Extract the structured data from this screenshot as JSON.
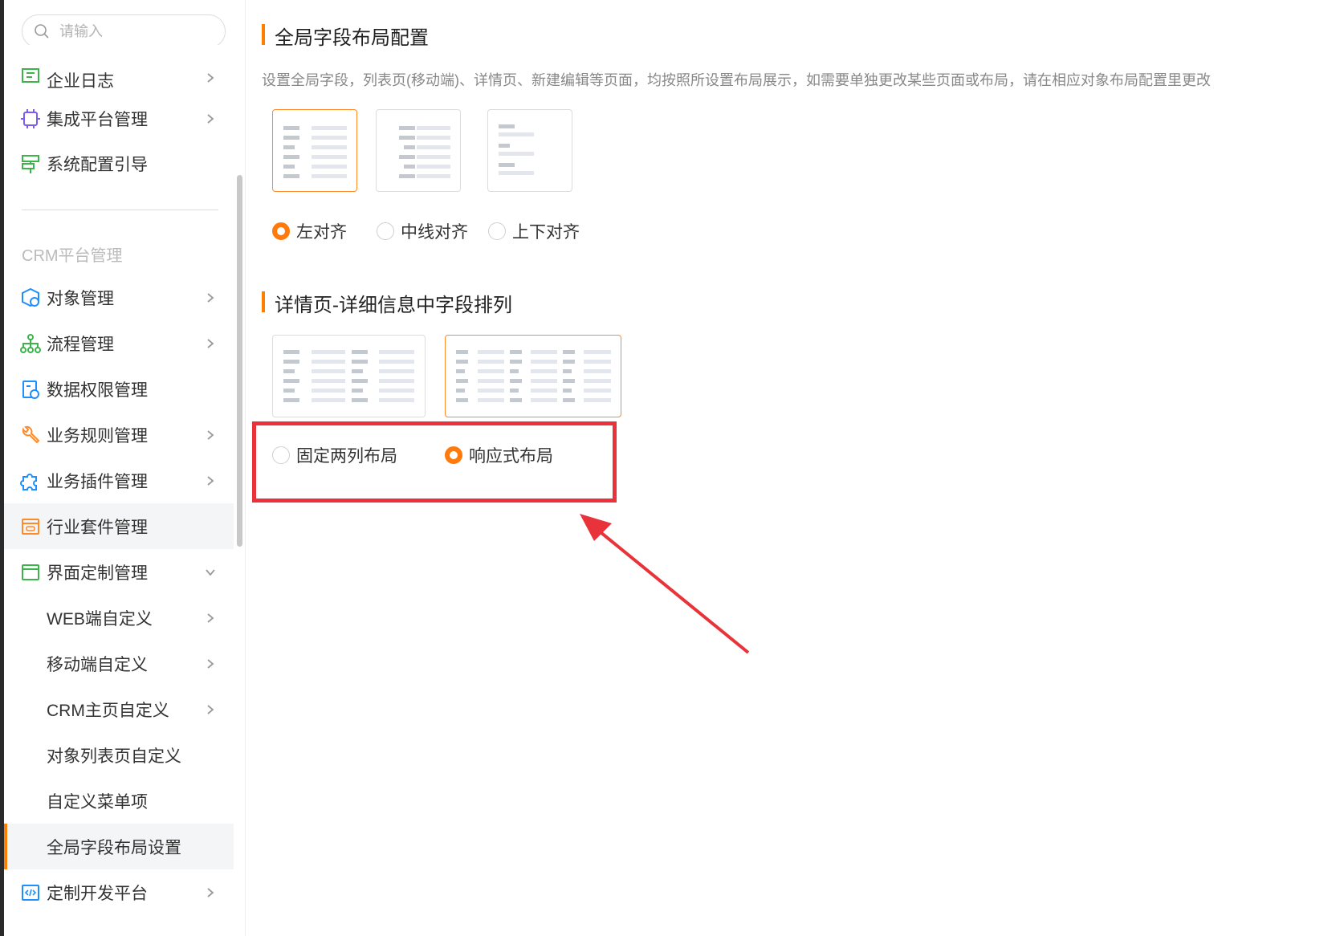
{
  "search": {
    "placeholder": "请输入"
  },
  "sidebar": {
    "items_top": [
      {
        "label": "企业日志",
        "icon": "log-icon"
      },
      {
        "label": "集成平台管理",
        "icon": "chip-icon"
      },
      {
        "label": "系统配置引导",
        "icon": "signpost-icon"
      }
    ],
    "section_label": "CRM平台管理",
    "items": [
      {
        "label": "对象管理",
        "icon": "object-icon"
      },
      {
        "label": "流程管理",
        "icon": "flow-icon"
      },
      {
        "label": "数据权限管理",
        "icon": "data-permission-icon"
      },
      {
        "label": "业务规则管理",
        "icon": "wrench-icon"
      },
      {
        "label": "业务插件管理",
        "icon": "puzzle-icon"
      },
      {
        "label": "行业套件管理",
        "icon": "suite-icon"
      },
      {
        "label": "界面定制管理",
        "icon": "window-icon"
      }
    ],
    "sub_items": [
      {
        "label": "WEB端自定义"
      },
      {
        "label": "移动端自定义"
      },
      {
        "label": "CRM主页自定义"
      },
      {
        "label": "对象列表页自定义"
      },
      {
        "label": "自定义菜单项"
      },
      {
        "label": "全局字段布局设置"
      }
    ],
    "bottom_item": {
      "label": "定制开发平台",
      "icon": "code-icon"
    }
  },
  "main": {
    "section1": {
      "title": "全局字段布局配置",
      "description": "设置全局字段，列表页(移动端)、详情页、新建编辑等页面，均按照所设置布局展示，如需要单独更改某些页面或布局，请在相应对象布局配置里更改",
      "options": [
        {
          "label": "左对齐",
          "selected": true
        },
        {
          "label": "中线对齐",
          "selected": false
        },
        {
          "label": "上下对齐",
          "selected": false
        }
      ]
    },
    "section2": {
      "title": "详情页-详细信息中字段排列",
      "options": [
        {
          "label": "固定两列布局",
          "selected": false
        },
        {
          "label": "响应式布局",
          "selected": true
        }
      ]
    }
  },
  "colors": {
    "accent": "#ff8000",
    "annotation": "#e8333a"
  }
}
